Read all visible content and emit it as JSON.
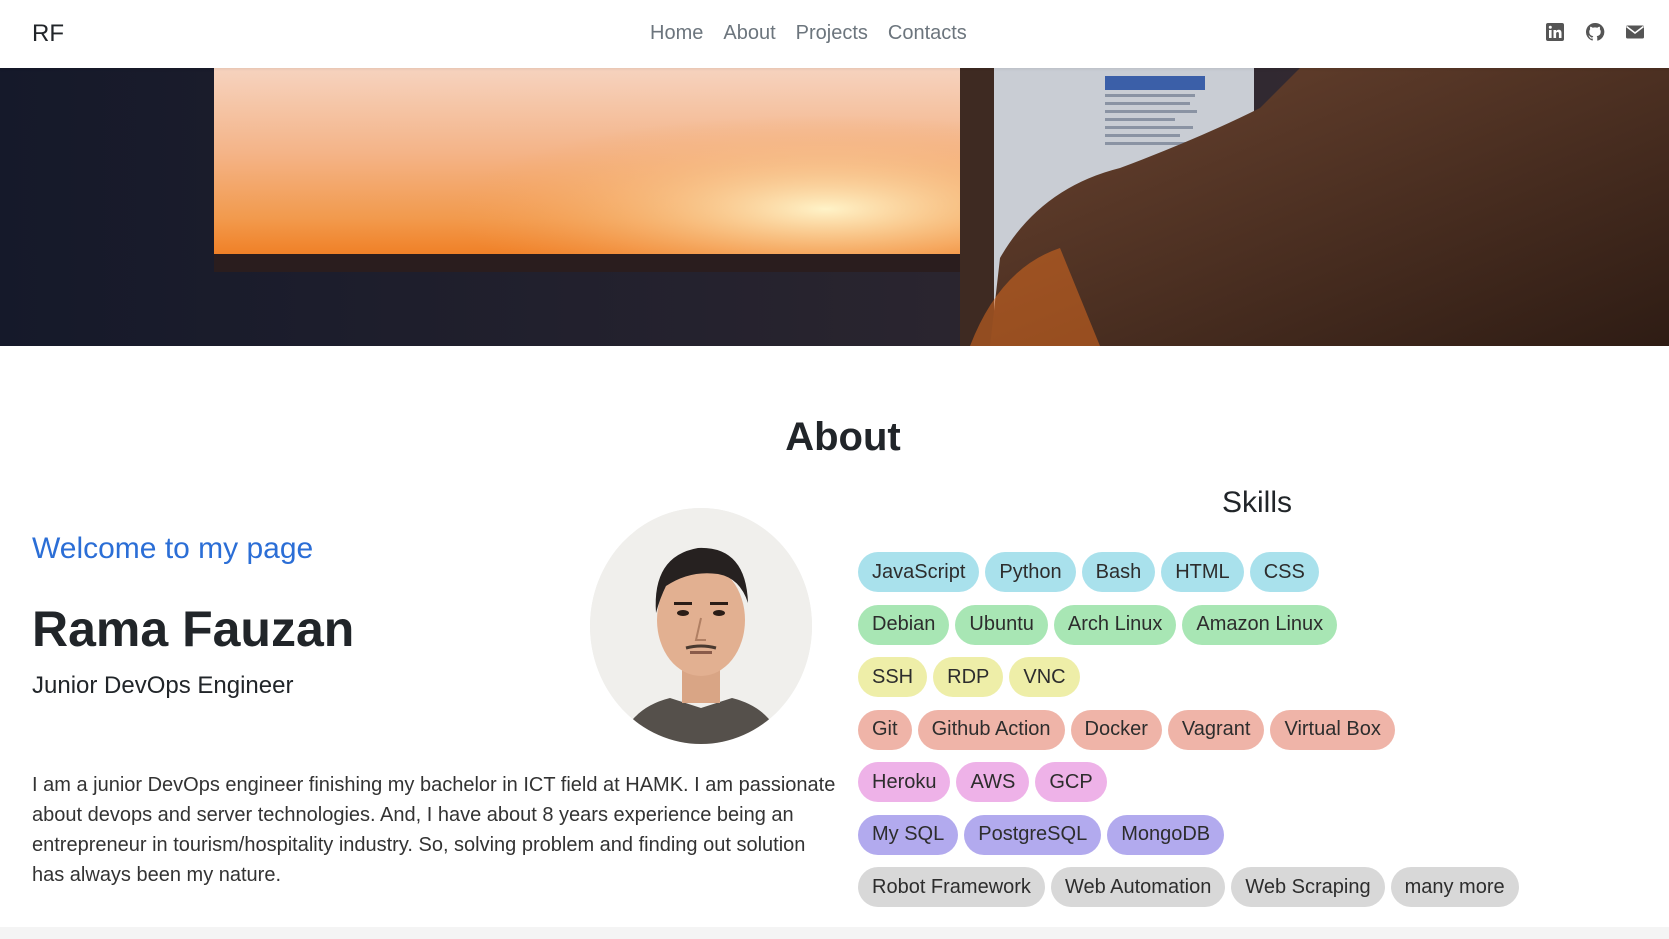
{
  "nav": {
    "brand": "RF",
    "links": [
      "Home",
      "About",
      "Projects",
      "Contacts"
    ],
    "icons": [
      "linkedin-icon",
      "github-icon",
      "envelope-icon"
    ]
  },
  "about": {
    "title": "About",
    "welcome": "Welcome to my page",
    "name": "Rama Fauzan",
    "role": "Junior DevOps Engineer",
    "bio": "I am a junior DevOps engineer finishing my bachelor in ICT field at HAMK. I am passionate about devops and server technologies. And, I have about 8 years experience being an entrepreneur in tourism/hospitality industry. So, solving problem and finding out solution has always been my nature."
  },
  "skills": {
    "title": "Skills",
    "groups": [
      {
        "color": "#a9e1ec",
        "items": [
          "JavaScript",
          "Python",
          "Bash",
          "HTML",
          "CSS"
        ]
      },
      {
        "color": "#a8e6b4",
        "items": [
          "Debian",
          "Ubuntu",
          "Arch Linux",
          "Amazon Linux"
        ]
      },
      {
        "color": "#eeeea8",
        "items": [
          "SSH",
          "RDP",
          "VNC"
        ]
      },
      {
        "color": "#efb4a8",
        "items": [
          "Git",
          "Github Action",
          "Docker",
          "Vagrant",
          "Virtual Box"
        ]
      },
      {
        "color": "#eeb2e8",
        "items": [
          "Heroku",
          "AWS",
          "GCP"
        ]
      },
      {
        "color": "#b2aaee",
        "items": [
          "My SQL",
          "PostgreSQL",
          "MongoDB"
        ]
      },
      {
        "color": "#d8d8d8",
        "items": [
          "Robot Framework",
          "Web Automation",
          "Web Scraping",
          "many more"
        ]
      }
    ]
  },
  "colors": {
    "accent": "#2b6ed6",
    "text": "#212529",
    "nav_link": "#6c757d"
  }
}
